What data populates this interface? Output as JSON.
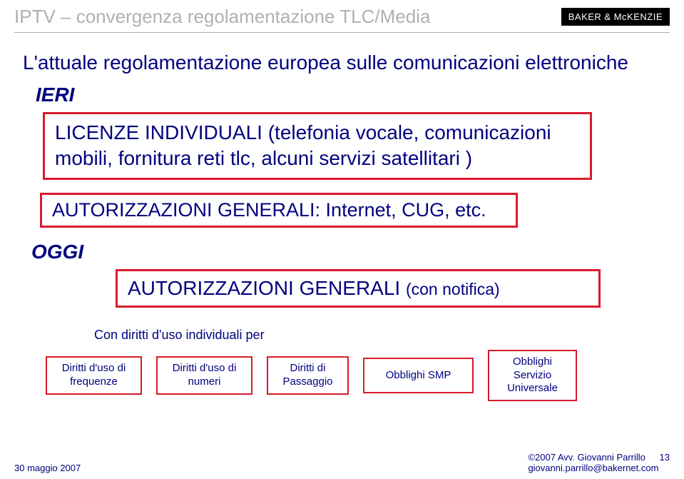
{
  "header": {
    "title": "IPTV – convergenza regolamentazione TLC/Media",
    "logo_text": "BAKER & MᴄKENZIE"
  },
  "subtitle": "L'attuale regolamentazione europea sulle comunicazioni elettroniche",
  "ieri_label": "IERI",
  "box1_line1": "LICENZE INDIVIDUALI (telefonia vocale, comunicazioni",
  "box1_line2": "mobili, fornitura reti tlc, alcuni servizi satellitari )",
  "box2_text": "AUTORIZZAZIONI GENERALI: Internet, CUG, etc.",
  "oggi_label": "OGGI",
  "box3_main": "AUTORIZZAZIONI GENERALI ",
  "box3_small": "(con notifica)",
  "diritti_label": "Con diritti d'uso individuali per",
  "small_boxes": {
    "b1_l1": "Diritti d'uso di",
    "b1_l2": "frequenze",
    "b2_l1": "Diritti d'uso di",
    "b2_l2": "numeri",
    "b3_l1": "Diritti di",
    "b3_l2": "Passaggio",
    "b4": "Obblighi SMP",
    "b5_l1": "Obblighi",
    "b5_l2": "Servizio",
    "b5_l3": "Universale"
  },
  "footer": {
    "date": "30 maggio 2007",
    "copyright": "©2007 Avv. Giovanni Parrillo",
    "email": "giovanni.parrillo@bakernet.com",
    "page": "13"
  }
}
